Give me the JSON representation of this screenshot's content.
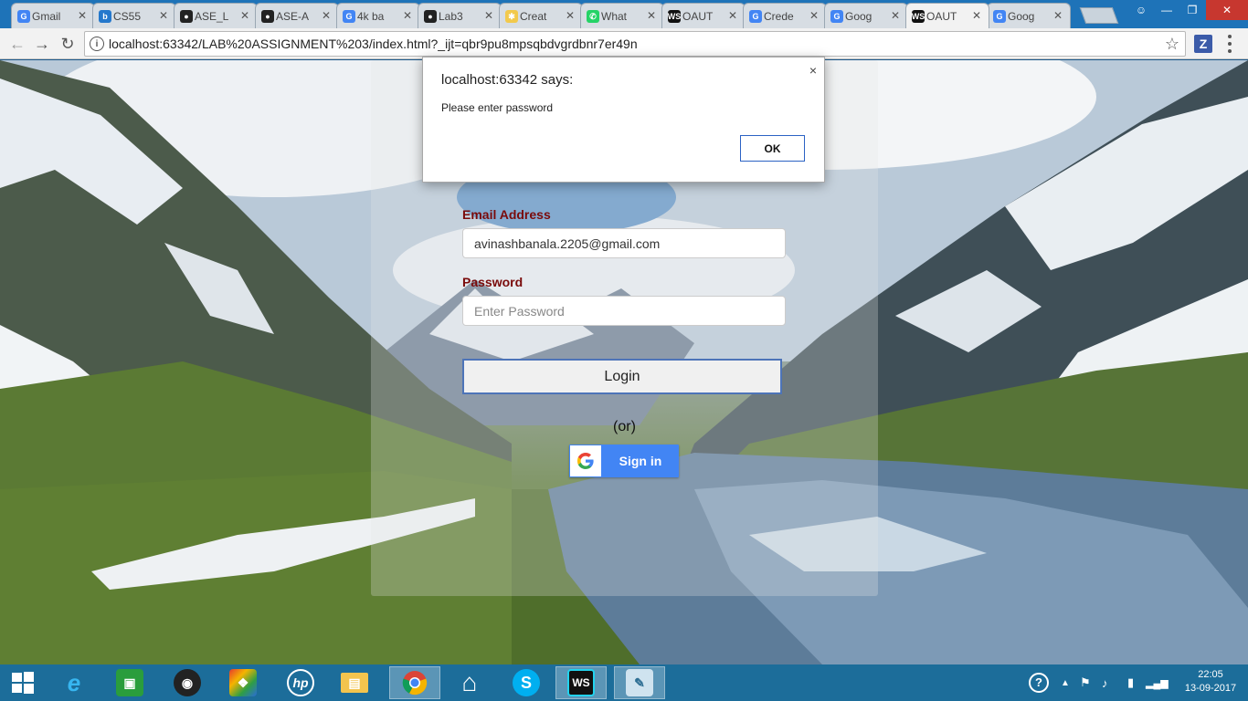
{
  "browser": {
    "tabs": [
      {
        "label": "Gmail",
        "icon": "google-icon",
        "color": "#4285f4"
      },
      {
        "label": "CS55",
        "icon": "box-icon",
        "color": "#2478cc"
      },
      {
        "label": "ASE_L",
        "icon": "github-icon",
        "color": "#222222"
      },
      {
        "label": "ASE-A",
        "icon": "github-icon",
        "color": "#222222"
      },
      {
        "label": "4k ba",
        "icon": "google-icon",
        "color": "#4285f4"
      },
      {
        "label": "Lab3",
        "icon": "github-icon",
        "color": "#222222"
      },
      {
        "label": "Creat",
        "icon": "bulb-icon",
        "color": "#f2c94c"
      },
      {
        "label": "What",
        "icon": "whatsapp-icon",
        "color": "#25d366"
      },
      {
        "label": "OAUT",
        "icon": "webstorm-icon",
        "color": "#111111"
      },
      {
        "label": "Crede",
        "icon": "google-icon",
        "color": "#4285f4"
      },
      {
        "label": "Goog",
        "icon": "google-icon",
        "color": "#4285f4"
      },
      {
        "label": "OAUT",
        "icon": "webstorm-icon",
        "color": "#111111"
      },
      {
        "label": "Goog",
        "icon": "google-icon",
        "color": "#4285f4"
      }
    ],
    "active_tab_index": 11,
    "url": "localhost:63342/LAB%20ASSIGNMENT%203/index.html?_ijt=qbr9pu8mpsqbdvgrdbnr7er49n",
    "extension_label": "Z"
  },
  "dialog": {
    "title": "localhost:63342 says:",
    "message": "Please enter password",
    "ok_label": "OK",
    "close_glyph": "×"
  },
  "login": {
    "email_label": "Email Address",
    "email_value": "avinashbanala.2205@gmail.com",
    "password_label": "Password",
    "password_placeholder": "Enter Password",
    "login_label": "Login",
    "or_text": "(or)",
    "google_signin_label": "Sign in"
  },
  "taskbar": {
    "clock_time": "22:05",
    "clock_date": "13-09-2017"
  },
  "colors": {
    "tab_strip": "#1e73b8",
    "label_red": "#7a0b0b",
    "google_blue": "#4285f4",
    "taskbar": "#1c6d9a"
  }
}
